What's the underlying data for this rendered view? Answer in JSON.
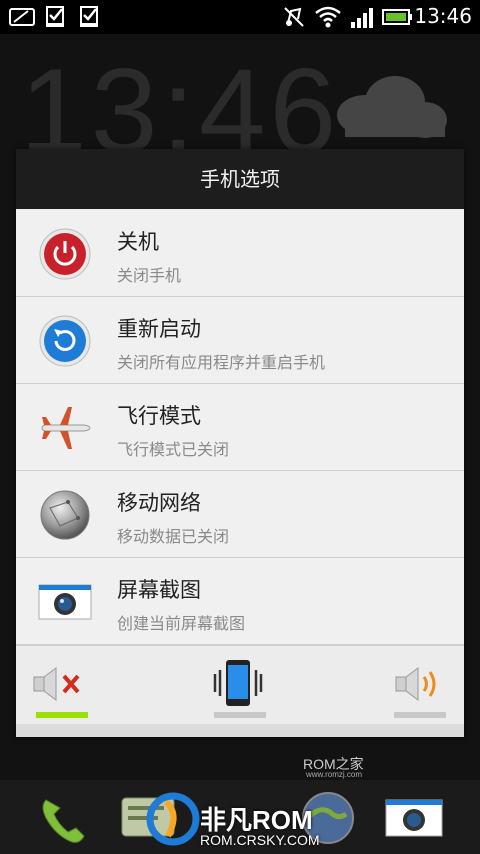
{
  "status_bar": {
    "time": "13:46",
    "left_icons": [
      "message-icon",
      "checklist-icon",
      "checklist-icon"
    ],
    "right_icons": [
      "mute-icon",
      "wifi-icon",
      "signal-icon",
      "battery-icon"
    ]
  },
  "background": {
    "clock": "13:46",
    "weather_icon": "cloud-icon"
  },
  "dialog": {
    "title": "手机选项",
    "options": [
      {
        "title": "关机",
        "subtitle": "关闭手机",
        "icon": "power-icon"
      },
      {
        "title": "重新启动",
        "subtitle": "关闭所有应用程序并重启手机",
        "icon": "restart-icon"
      },
      {
        "title": "飞行模式",
        "subtitle": "飞行模式已关闭",
        "icon": "airplane-icon"
      },
      {
        "title": "移动网络",
        "subtitle": "移动数据已关闭",
        "icon": "network-globe-icon"
      },
      {
        "title": "屏幕截图",
        "subtitle": "创建当前屏幕截图",
        "icon": "screenshot-camera-icon"
      }
    ],
    "sound_modes": [
      {
        "icon": "mute-speaker-icon",
        "active": true
      },
      {
        "icon": "vibrate-phone-icon",
        "active": false
      },
      {
        "icon": "speaker-on-icon",
        "active": false
      }
    ]
  },
  "watermark": {
    "rom": "ROM之家",
    "rom_sub": "www.romzj.com"
  },
  "dock": {
    "icons": [
      "phone-icon",
      "messages-icon",
      "browser-icon",
      "camera-icon"
    ],
    "brand": "非凡ROM",
    "brand_sub": "ROM.CRSKY.COM"
  },
  "colors": {
    "accent_active": "#9be000",
    "power_red": "#c8212b",
    "restart_blue": "#1e7bd6"
  }
}
